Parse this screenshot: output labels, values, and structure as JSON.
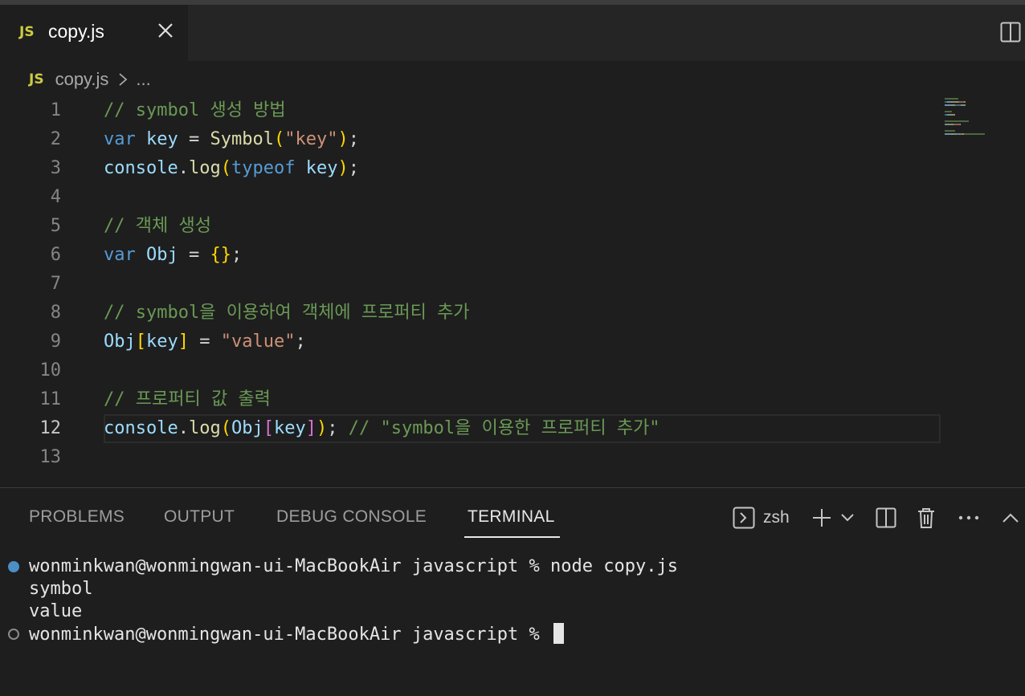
{
  "tab": {
    "lang_badge": "JS",
    "filename": "copy.js"
  },
  "breadcrumb": {
    "lang_badge": "JS",
    "file": "copy.js",
    "more": "..."
  },
  "editor": {
    "active_line": 12,
    "lines": [
      {
        "n": "1",
        "tokens": [
          {
            "t": "// symbol 생성 방법",
            "c": "cm"
          }
        ]
      },
      {
        "n": "2",
        "tokens": [
          {
            "t": "var",
            "c": "kw"
          },
          {
            "t": " ",
            "c": "pl"
          },
          {
            "t": "key",
            "c": "var"
          },
          {
            "t": " = ",
            "c": "pl"
          },
          {
            "t": "Symbol",
            "c": "fn"
          },
          {
            "t": "(",
            "c": "br1"
          },
          {
            "t": "\"key\"",
            "c": "str"
          },
          {
            "t": ")",
            "c": "br1"
          },
          {
            "t": ";",
            "c": "pl"
          }
        ]
      },
      {
        "n": "3",
        "tokens": [
          {
            "t": "console",
            "c": "var"
          },
          {
            "t": ".",
            "c": "pl"
          },
          {
            "t": "log",
            "c": "fn"
          },
          {
            "t": "(",
            "c": "br1"
          },
          {
            "t": "typeof",
            "c": "kw"
          },
          {
            "t": " ",
            "c": "pl"
          },
          {
            "t": "key",
            "c": "var"
          },
          {
            "t": ")",
            "c": "br1"
          },
          {
            "t": ";",
            "c": "pl"
          }
        ]
      },
      {
        "n": "4",
        "tokens": []
      },
      {
        "n": "5",
        "tokens": [
          {
            "t": "// 객체 생성",
            "c": "cm"
          }
        ]
      },
      {
        "n": "6",
        "tokens": [
          {
            "t": "var",
            "c": "kw"
          },
          {
            "t": " ",
            "c": "pl"
          },
          {
            "t": "Obj",
            "c": "var"
          },
          {
            "t": " = ",
            "c": "pl"
          },
          {
            "t": "{}",
            "c": "br1"
          },
          {
            "t": ";",
            "c": "pl"
          }
        ]
      },
      {
        "n": "7",
        "tokens": []
      },
      {
        "n": "8",
        "tokens": [
          {
            "t": "// symbol을 이용하여 객체에 프로퍼티 추가",
            "c": "cm"
          }
        ]
      },
      {
        "n": "9",
        "tokens": [
          {
            "t": "Obj",
            "c": "var"
          },
          {
            "t": "[",
            "c": "br1"
          },
          {
            "t": "key",
            "c": "var"
          },
          {
            "t": "]",
            "c": "br1"
          },
          {
            "t": " = ",
            "c": "pl"
          },
          {
            "t": "\"value\"",
            "c": "str"
          },
          {
            "t": ";",
            "c": "pl"
          }
        ]
      },
      {
        "n": "10",
        "tokens": []
      },
      {
        "n": "11",
        "tokens": [
          {
            "t": "// 프로퍼티 값 출력",
            "c": "cm"
          }
        ]
      },
      {
        "n": "12",
        "tokens": [
          {
            "t": "console",
            "c": "var"
          },
          {
            "t": ".",
            "c": "pl"
          },
          {
            "t": "log",
            "c": "fn"
          },
          {
            "t": "(",
            "c": "br1"
          },
          {
            "t": "Obj",
            "c": "var"
          },
          {
            "t": "[",
            "c": "br2"
          },
          {
            "t": "key",
            "c": "var"
          },
          {
            "t": "]",
            "c": "br2"
          },
          {
            "t": ")",
            "c": "br1"
          },
          {
            "t": "; ",
            "c": "pl"
          },
          {
            "t": "// \"symbol을 이용한 프로퍼티 추가\"",
            "c": "cm"
          }
        ]
      },
      {
        "n": "13",
        "tokens": []
      }
    ]
  },
  "panel": {
    "tabs": [
      "PROBLEMS",
      "OUTPUT",
      "DEBUG CONSOLE",
      "TERMINAL"
    ],
    "active_tab": "TERMINAL",
    "shell": "zsh"
  },
  "terminal": {
    "lines": [
      {
        "text": "wonminkwan@wonmingwan-ui-MacBookAir javascript % node copy.js",
        "marker": "filled"
      },
      {
        "text": "symbol",
        "marker": "none"
      },
      {
        "text": "value",
        "marker": "none"
      },
      {
        "text": "wonminkwan@wonmingwan-ui-MacBookAir javascript % ",
        "marker": "hollow",
        "cursor": true
      }
    ]
  },
  "colors": {
    "keyword": "#569cd6",
    "variable": "#9cdcfe",
    "function": "#dcdcaa",
    "string": "#ce9178",
    "comment": "#6a9955",
    "bracket1": "#ffd700",
    "bracket2": "#da70d6",
    "marker_blue": "#3794ff"
  },
  "icons": {
    "tab_close": "close-icon",
    "split_editor": "split-editor-icon",
    "breadcrumb_sep": "chevron-right-icon",
    "terminal_shell": "terminal-icon",
    "new_terminal": "plus-icon",
    "launch_profile": "chevron-down-icon",
    "split_terminal": "split-terminal-icon",
    "kill_terminal": "trash-icon",
    "more": "ellipsis-icon",
    "maximize": "chevron-up-icon"
  }
}
